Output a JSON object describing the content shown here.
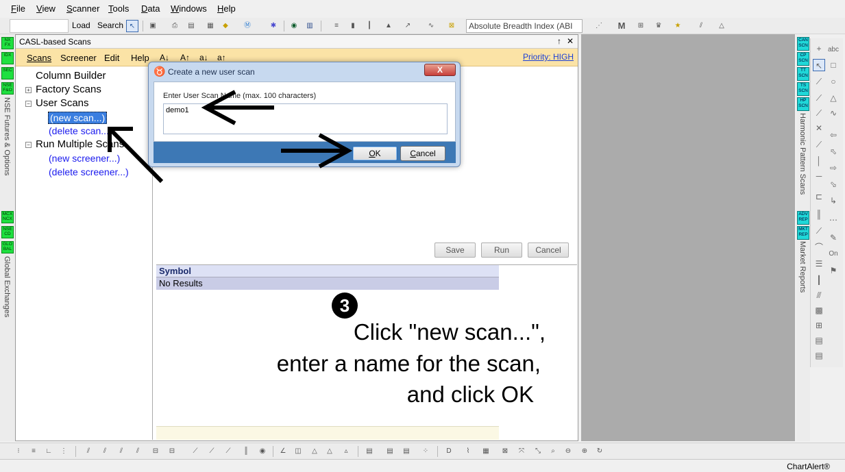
{
  "menu": [
    "File",
    "View",
    "Scanner",
    "Tools",
    "Data",
    "Windows",
    "Help"
  ],
  "toolbar": {
    "load_label": "Load",
    "search_label": "Search",
    "indicator_select": "Absolute Breadth Index (ABI"
  },
  "left_strip": {
    "badges_top": [
      "NX FX",
      "IDX",
      "SEC",
      "NSE F&O"
    ],
    "label_top": "NSE Futures & Options",
    "badges_bottom": [
      "MCX NCX",
      "NSE CD",
      "GLO BAL"
    ],
    "label_bottom": "Global Exchanges"
  },
  "panel": {
    "title": "CASL-based Scans",
    "pin_glyph": "↑",
    "close_glyph": "✕",
    "menu": [
      "Scans",
      "Screener",
      "Edit",
      "Help"
    ],
    "font_buttons": [
      "A↓",
      "A↑",
      "a↓",
      "a↑"
    ],
    "priority": "Priority: HIGH"
  },
  "tree": {
    "column_builder": "Column Builder",
    "factory_scans": "Factory Scans",
    "user_scans": "User Scans",
    "new_scan": "(new scan...)",
    "delete_scan": "(delete scan...)",
    "run_multiple": "Run Multiple Scans",
    "new_screener": "(new screener...)",
    "delete_screener": "(delete screener...)"
  },
  "actions": {
    "save": "Save",
    "run": "Run",
    "cancel": "Cancel"
  },
  "results": {
    "header": "Symbol",
    "empty": "No Results"
  },
  "dialog": {
    "title": "Create a new user scan",
    "close": "X",
    "label": "Enter User Scan Name (max. 100 characters)",
    "value": "demo1",
    "ok": "OK",
    "cancel": "Cancel"
  },
  "instruction": {
    "step": "3",
    "line1": "Click \"new scan...\",",
    "line2": "enter a name for the scan,",
    "line3": "and click OK"
  },
  "right_strip": {
    "badges_top": [
      "CAN SCN",
      "CP SCN",
      "TT SCN",
      "TS SCN",
      "HP SCN"
    ],
    "label_top": "Harmonic Pattern Scans",
    "badges_bottom": [
      "ADV REP",
      "MKT REP"
    ],
    "label_bottom": "Market Reports"
  },
  "draw_tools": {
    "abc": "abc",
    "on": "On"
  },
  "status": {
    "app": "ChartAlert®"
  },
  "colors": {
    "panel_menu": "#fbe3a6",
    "dialog_footer": "#3d78b5",
    "selection": "#3a7ee0",
    "badge_green": "#1fe040",
    "badge_cyan": "#1fd8d8"
  }
}
